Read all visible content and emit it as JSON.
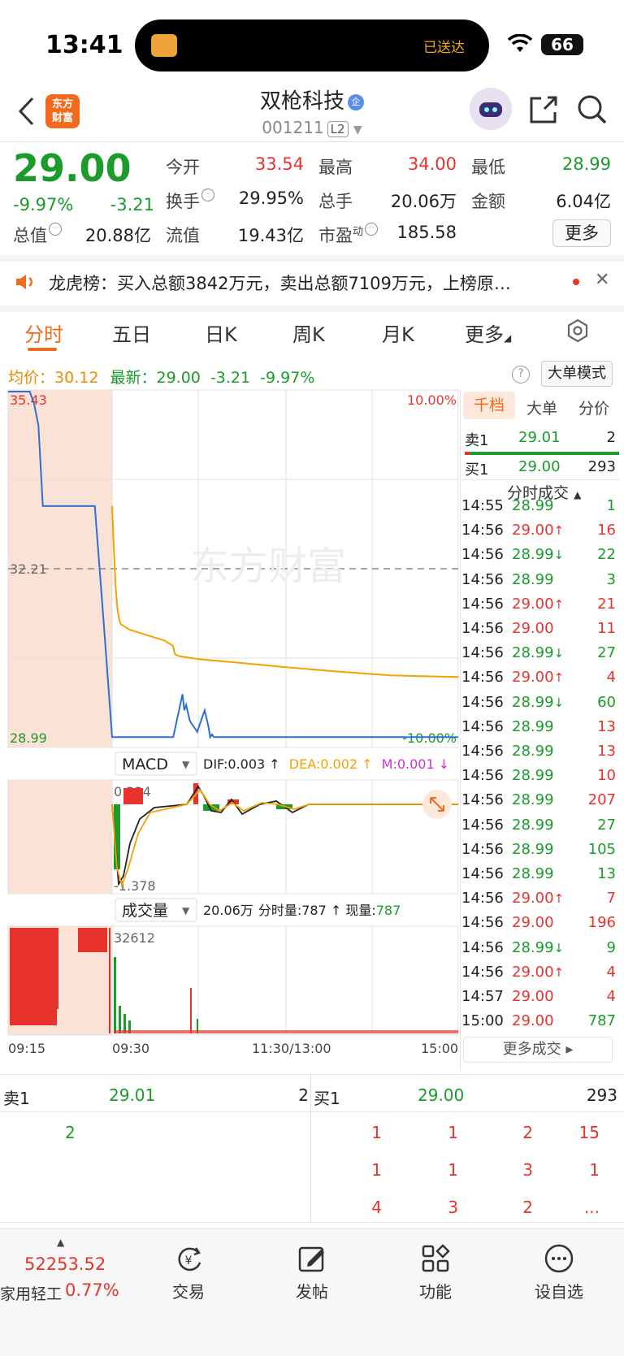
{
  "status_bar": {
    "time": "13:41",
    "island_text": "已送达",
    "battery": "66"
  },
  "nav": {
    "stock_name": "双枪科技",
    "name_badge": "企",
    "stock_code": "001211",
    "level_badge": "L2",
    "logo_line1": "东方",
    "logo_line2": "财富"
  },
  "quote": {
    "price": "29.00",
    "change_pct": "-9.97%",
    "change_amt": "-3.21",
    "open_label": "今开",
    "open": "33.54",
    "high_label": "最高",
    "high": "34.00",
    "low_label": "最低",
    "low": "28.99",
    "turnover_label": "换手",
    "turnover": "29.95%",
    "volume_label": "总手",
    "volume": "20.06万",
    "amount_label": "金额",
    "amount": "6.04亿",
    "mcap_label": "总值",
    "mcap": "20.88亿",
    "float_label": "流值",
    "float_cap": "19.43亿",
    "pe_label": "市盈",
    "pe_sup": "动",
    "pe": "185.58",
    "more_label": "更多"
  },
  "ticker": {
    "text": "龙虎榜：买入总额3842万元，卖出总额7109万元，上榜原…"
  },
  "tabs": [
    "分时",
    "五日",
    "日K",
    "周K",
    "月K",
    "更多"
  ],
  "info_line": {
    "avg_label": "均价：",
    "avg": "30.12",
    "latest_label": "最新：",
    "latest": "29.00",
    "chg": "-3.21",
    "pct": "-9.97%",
    "big_order_btn": "大单模式"
  },
  "chart_data": {
    "type": "line",
    "title": "",
    "price_labels": {
      "top": "35.43",
      "mid": "32.21",
      "bottom": "28.99",
      "top_pct": "10.00%",
      "bottom_pct": "-10.00%"
    },
    "x_ticks": [
      "09:15",
      "09:30",
      "11:30/13:00",
      "15:00"
    ],
    "ylim": [
      28.99,
      35.43
    ],
    "prev_close": 32.21,
    "series": [
      {
        "name": "",
        "color": "#2f6fd1",
        "x": [
          0,
          5,
          6,
          7,
          8,
          9,
          10,
          12,
          14,
          16,
          18,
          20,
          22,
          24,
          30,
          40,
          60,
          90,
          100,
          102,
          104,
          108,
          112,
          116,
          120,
          124,
          128,
          130,
          132,
          134,
          136,
          140,
          150,
          170,
          200,
          230,
          270,
          320,
          398
        ],
        "y": [
          35.43,
          35.43,
          35.2,
          34.8,
          33.3,
          33.3,
          33.3,
          33.3,
          33.3,
          33.3,
          33.3,
          33.3,
          31.2,
          29.0,
          29.0,
          29.0,
          29.0,
          29.0,
          29.8,
          29.5,
          29.6,
          29.3,
          29.2,
          29.1,
          29.3,
          29.5,
          29.2,
          29.0,
          29.05,
          29.0,
          29.0,
          29.0,
          29.0,
          29.0,
          29.0,
          29.0,
          29.0,
          29.0,
          29.0
        ]
      },
      {
        "name": "",
        "color": "#f5a200",
        "x": [
          0,
          2,
          4,
          6,
          8,
          10,
          20,
          40,
          60,
          70,
          72,
          75,
          80,
          100,
          150,
          200,
          260,
          320,
          398
        ],
        "y": [
          33.3,
          32.5,
          31.8,
          31.4,
          31.2,
          31.1,
          31.0,
          30.9,
          30.8,
          30.7,
          30.55,
          30.52,
          30.5,
          30.45,
          30.38,
          30.3,
          30.22,
          30.15,
          30.12
        ]
      }
    ]
  },
  "macd": {
    "label": "MACD",
    "dif_label": "DIF:",
    "dif": "0.003",
    "dea_label": "DEA:",
    "dea": "0.002",
    "m_label": "M:",
    "m": "0.001",
    "top": "0.334",
    "bottom": "-1.378"
  },
  "volume_panel": {
    "label": "成交量",
    "total": "20.06万",
    "period_label": "分时量:",
    "period": "787",
    "now_label": "现量:",
    "now": "787",
    "max": "32612"
  },
  "right_panel": {
    "tabs": [
      "千档",
      "大单",
      "分价"
    ],
    "ask1": {
      "label": "卖1",
      "price": "29.01",
      "vol": "2"
    },
    "bid1": {
      "label": "买1",
      "price": "29.00",
      "vol": "293"
    },
    "ticks_title": "分时成交",
    "ticks": [
      {
        "t": "14:55",
        "p": "28.99",
        "a": "",
        "v": "1",
        "c": "green"
      },
      {
        "t": "14:56",
        "p": "29.00",
        "a": "↑",
        "v": "16",
        "c": "red"
      },
      {
        "t": "14:56",
        "p": "28.99",
        "a": "↓",
        "v": "22",
        "c": "green"
      },
      {
        "t": "14:56",
        "p": "28.99",
        "a": "",
        "v": "3",
        "c": "green"
      },
      {
        "t": "14:56",
        "p": "29.00",
        "a": "↑",
        "v": "21",
        "c": "red"
      },
      {
        "t": "14:56",
        "p": "29.00",
        "a": "",
        "v": "11",
        "c": "red"
      },
      {
        "t": "14:56",
        "p": "28.99",
        "a": "↓",
        "v": "27",
        "c": "green"
      },
      {
        "t": "14:56",
        "p": "29.00",
        "a": "↑",
        "v": "4",
        "c": "red"
      },
      {
        "t": "14:56",
        "p": "28.99",
        "a": "↓",
        "v": "60",
        "c": "green"
      },
      {
        "t": "14:56",
        "p": "28.99",
        "a": "",
        "v": "13",
        "c": "red"
      },
      {
        "t": "14:56",
        "p": "28.99",
        "a": "",
        "v": "13",
        "c": "red"
      },
      {
        "t": "14:56",
        "p": "28.99",
        "a": "",
        "v": "10",
        "c": "red"
      },
      {
        "t": "14:56",
        "p": "28.99",
        "a": "",
        "v": "207",
        "c": "red"
      },
      {
        "t": "14:56",
        "p": "28.99",
        "a": "",
        "v": "27",
        "c": "green"
      },
      {
        "t": "14:56",
        "p": "28.99",
        "a": "",
        "v": "105",
        "c": "green"
      },
      {
        "t": "14:56",
        "p": "28.99",
        "a": "",
        "v": "13",
        "c": "green"
      },
      {
        "t": "14:56",
        "p": "29.00",
        "a": "↑",
        "v": "7",
        "c": "red"
      },
      {
        "t": "14:56",
        "p": "29.00",
        "a": "",
        "v": "196",
        "c": "red"
      },
      {
        "t": "14:56",
        "p": "28.99",
        "a": "↓",
        "v": "9",
        "c": "green"
      },
      {
        "t": "14:56",
        "p": "29.00",
        "a": "↑",
        "v": "4",
        "c": "red"
      },
      {
        "t": "14:57",
        "p": "29.00",
        "a": "",
        "v": "4",
        "c": "red"
      },
      {
        "t": "15:00",
        "p": "29.00",
        "a": "",
        "v": "787",
        "c": "green"
      }
    ],
    "more_ticks": "更多成交"
  },
  "order_book": {
    "ask_label": "卖1",
    "ask_price": "29.01",
    "ask_vol": "2",
    "bid_label": "买1",
    "bid_price": "29.00",
    "bid_vol": "293",
    "ask_queue": [
      "2"
    ],
    "bid_queue": [
      [
        "1",
        "1",
        "2",
        "15"
      ],
      [
        "1",
        "1",
        "3",
        "1"
      ],
      [
        "4",
        "3",
        "2",
        "..."
      ]
    ]
  },
  "bottom_bar": {
    "index_value": "52253.52",
    "index_name": "家用轻工",
    "index_pct": "0.77%",
    "items": [
      "交易",
      "发帖",
      "功能",
      "设自选"
    ]
  }
}
